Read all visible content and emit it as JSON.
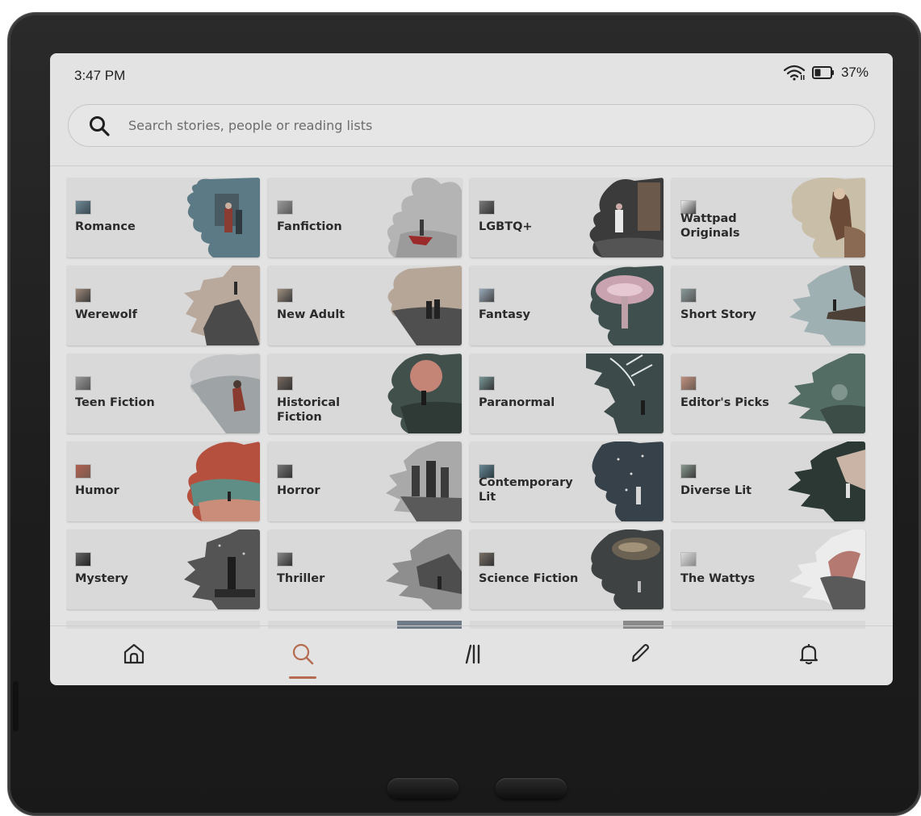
{
  "status": {
    "time": "3:47 PM",
    "battery": "37%"
  },
  "search": {
    "placeholder": "Search stories, people or reading lists"
  },
  "categories": [
    {
      "label": "Romance"
    },
    {
      "label": "Fanfiction"
    },
    {
      "label": "LGBTQ+"
    },
    {
      "label": "Wattpad Originals"
    },
    {
      "label": "Werewolf"
    },
    {
      "label": "New Adult"
    },
    {
      "label": "Fantasy"
    },
    {
      "label": "Short Story"
    },
    {
      "label": "Teen Fiction"
    },
    {
      "label": "Historical Fiction"
    },
    {
      "label": "Paranormal"
    },
    {
      "label": "Editor's Picks"
    },
    {
      "label": "Humor"
    },
    {
      "label": "Horror"
    },
    {
      "label": "Contemporary Lit"
    },
    {
      "label": "Diverse Lit"
    },
    {
      "label": "Mystery"
    },
    {
      "label": "Thriller"
    },
    {
      "label": "Science Fiction"
    },
    {
      "label": "The Wattys"
    }
  ],
  "nav": {
    "items": [
      "home-icon",
      "search-icon",
      "library-icon",
      "write-icon",
      "notifications-icon"
    ],
    "active": "search-icon"
  },
  "colors": {
    "accent": "#b56b50",
    "screen_bg": "#e3e3e3",
    "card_bg": "#d9d9d9",
    "bezel": "#1d1d1d"
  }
}
